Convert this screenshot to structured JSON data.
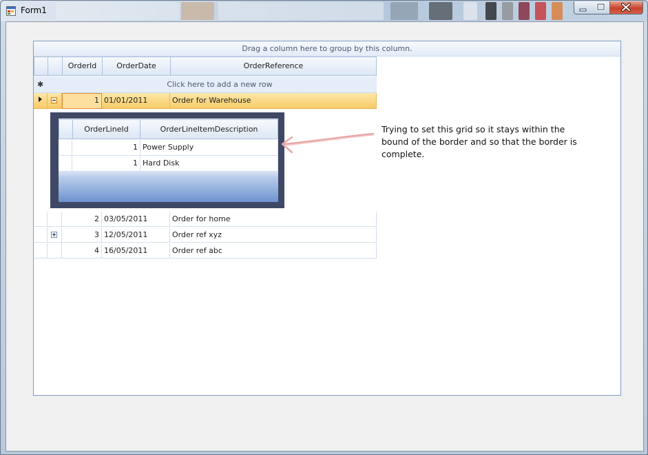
{
  "window": {
    "title": "Form1",
    "controls": {
      "minimize": "minimize-icon",
      "maximize": "maximize-icon",
      "close": "close-icon"
    }
  },
  "grid": {
    "group_panel_text": "Drag a column here to group by this column.",
    "columns": [
      "OrderId",
      "OrderDate",
      "OrderReference"
    ],
    "new_row_text": "Click here to add a new row",
    "rows": [
      {
        "id": "1",
        "date": "01/01/2011",
        "reference": "Order for Warehouse",
        "selected": true,
        "expanded": true
      },
      {
        "id": "2",
        "date": "03/05/2011",
        "reference": "Order for home"
      },
      {
        "id": "3",
        "date": "12/05/2011",
        "reference": "Order ref xyz",
        "expandable": true
      },
      {
        "id": "4",
        "date": "16/05/2011",
        "reference": "Order ref abc"
      }
    ],
    "detail": {
      "columns": [
        "OrderLineId",
        "OrderLineItemDescription"
      ],
      "rows": [
        {
          "id": "1",
          "description": "Power Supply"
        },
        {
          "id": "1",
          "description": "Hard Disk"
        }
      ]
    }
  },
  "annotation": {
    "text": "Trying to set this grid so it stays within the bound of the border and so that the border is complete.",
    "color": "#e8a6a6"
  },
  "colors": {
    "selection": "#f7c964",
    "grid_border": "#7a9cc9",
    "detail_border": "#3f4865"
  }
}
